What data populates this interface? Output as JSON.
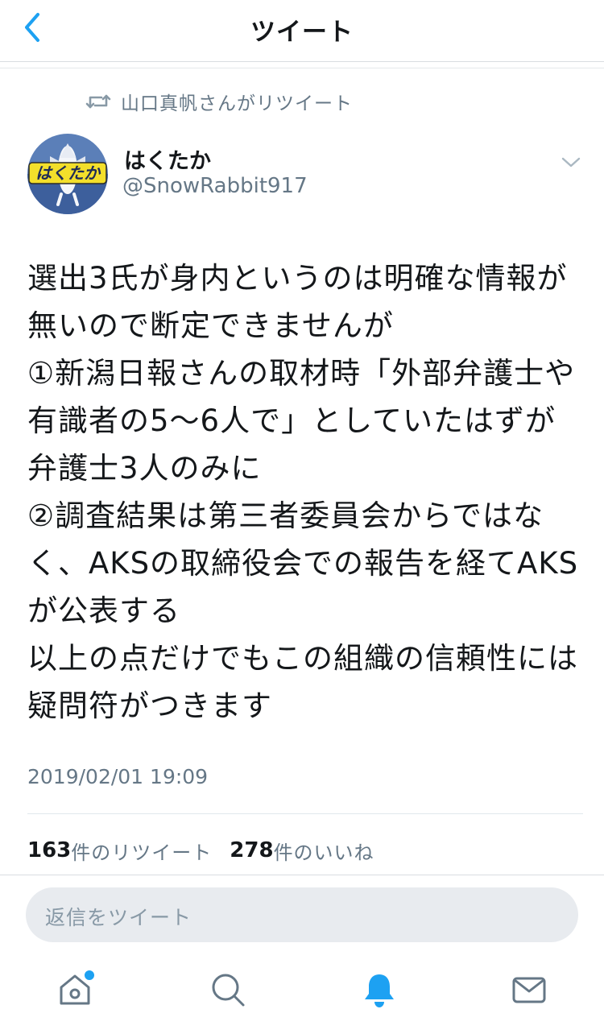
{
  "header": {
    "title": "ツイート",
    "back_icon": "chevron-left-icon"
  },
  "retweet_context": {
    "text": "山口真帆さんがリツイート",
    "icon": "retweet-icon"
  },
  "author": {
    "name": "はくたか",
    "handle": "@SnowRabbit917",
    "avatar_text": "はくたか"
  },
  "tweet": {
    "text": "選出3氏が身内というのは明確な情報が無いので断定できませんが\n①新潟日報さんの取材時「外部弁護士や有識者の5〜6人で」としていたはずが弁護士3人のみに\n②調査結果は第三者委員会からではなく、AKSの取締役会での報告を経てAKSが公表する\n以上の点だけでもこの組織の信頼性には疑問符がつきます",
    "timestamp": "2019/02/01 19:09"
  },
  "stats": {
    "retweets_count": "163",
    "retweets_label": "件のリツイート",
    "likes_count": "278",
    "likes_label": "件のいいね"
  },
  "reply": {
    "placeholder": "返信をツイート"
  },
  "tabbar": {
    "items": [
      "home-icon",
      "search-icon",
      "notifications-icon",
      "messages-icon"
    ],
    "active": "notifications-icon",
    "home_has_badge": true
  },
  "colors": {
    "accent": "#1da1f2",
    "secondary_text": "#657786",
    "icon_gray": "#657786"
  }
}
